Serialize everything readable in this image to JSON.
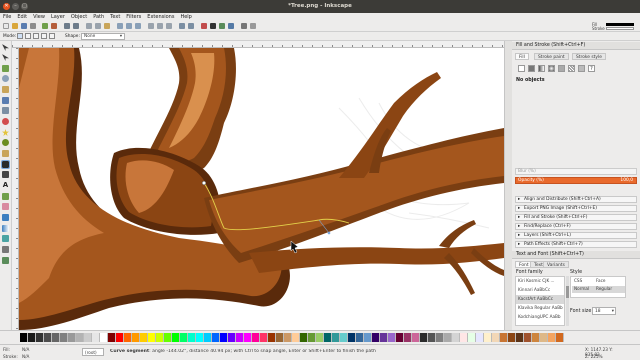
{
  "window": {
    "title": "*Tree.png - Inkscape"
  },
  "menu": [
    "File",
    "Edit",
    "View",
    "Layer",
    "Object",
    "Path",
    "Text",
    "Filters",
    "Extensions",
    "Help"
  ],
  "tool_controls": {
    "mode_label": "Mode:",
    "shape_label": "Shape:",
    "shape_value": "None"
  },
  "canvas": {
    "colors": {
      "bark_dark": "#7a3e12",
      "bark_mid": "#a4561d",
      "bark_light": "#c8763a",
      "bark_shadow": "#5a2a0b",
      "highlight": "#d9904e"
    }
  },
  "fill_stroke_mini": {
    "fill_label": "Fill",
    "stroke_label": "Stroke"
  },
  "panel": {
    "fill_stroke_title": "Fill and Stroke (Shift+Ctrl+F)",
    "tabs": [
      "Fill",
      "Stroke paint",
      "Stroke style"
    ],
    "no_objects": "No objects",
    "blur_label": "Blur (%)",
    "opacity_label": "Opacity (%)",
    "opacity_value": "100,0",
    "collapsed": [
      "Align and Distribute (Shift+Ctrl+A)",
      "Export PNG Image (Shift+Ctrl+E)",
      "Fill and Stroke (Shift+Ctrl+F)",
      "Find/Replace (Ctrl+F)",
      "Layers (Shift+Ctrl+L)",
      "Path Effects (Shift+Ctrl+7)"
    ],
    "text_font_title": "Text and Font (Shift+Ctrl+T)",
    "text_tabs": [
      "Font",
      "Text",
      "Variants"
    ],
    "font_family_label": "Font family",
    "style_label": "Style",
    "css_label": "CSS",
    "face_label": "Face",
    "style_css": "Normal",
    "style_face": "Regular",
    "fonts": [
      "Kiri Kosmic CJK ...",
      "Kinnari  AaBbCc",
      "KacstArt  AaBbCc",
      "Klavika Regular  AaBb",
      "KodchiangUPC  AaBb"
    ],
    "font_size_label": "Font size",
    "font_size_value": "18"
  },
  "status": {
    "fill_label": "Fill:",
    "fill_value": "N/A",
    "stroke_label": "Stroke:",
    "stroke_value": "N/A",
    "layer": "(root)",
    "message_prefix": "Curve segment",
    "message_rest": ": angle -144.02°, distance 40.94 px; with Ctrl to snap angle, Enter or Shift+Enter to finish the path",
    "coords": "X: 1147.23  Y: 835.82",
    "zoom": "Z: 225%"
  },
  "palette_colors": [
    "#000000",
    "#1a1a1a",
    "#333333",
    "#4d4d4d",
    "#666666",
    "#808080",
    "#999999",
    "#b3b3b3",
    "#cccccc",
    "#e6e6e6",
    "#ffffff",
    "#800000",
    "#ff0000",
    "#ff6600",
    "#ff9900",
    "#ffcc00",
    "#ffff00",
    "#ccff00",
    "#66ff00",
    "#00ff00",
    "#00ff66",
    "#00ffcc",
    "#00ffff",
    "#00ccff",
    "#0066ff",
    "#0000ff",
    "#6600ff",
    "#cc00ff",
    "#ff00ff",
    "#ff0099",
    "#ff3366",
    "#993300",
    "#996633",
    "#cc9966",
    "#ffcc99",
    "#336600",
    "#669933",
    "#99cc66",
    "#006666",
    "#339999",
    "#66cccc",
    "#003366",
    "#336699",
    "#6699cc",
    "#330066",
    "#663399",
    "#9966cc",
    "#660033",
    "#993366",
    "#cc6699",
    "#2b2b2b",
    "#555555",
    "#7f7f7f",
    "#aaaaaa",
    "#d4d4d4",
    "#ffe6e6",
    "#e6ffe6",
    "#e6e6ff",
    "#fff0cc",
    "#f2d7b6",
    "#c87533",
    "#8b4513",
    "#5c3317",
    "#a0522d",
    "#cd853f",
    "#deb887",
    "#f4a460",
    "#d2691e"
  ]
}
